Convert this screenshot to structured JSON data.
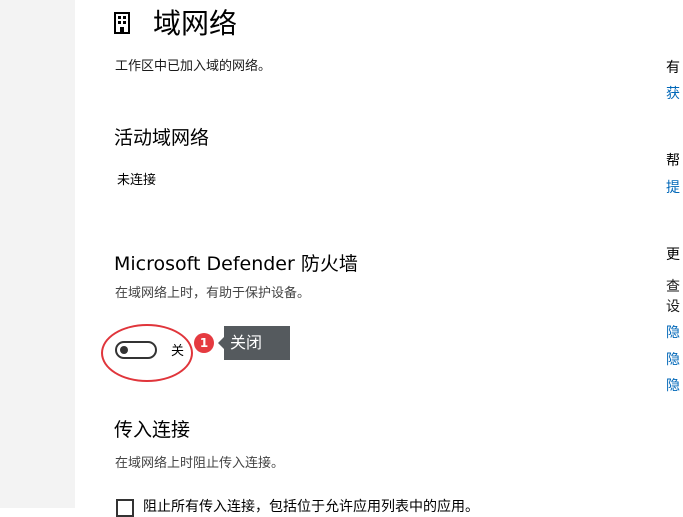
{
  "page": {
    "title": "域网络",
    "description": "工作区中已加入域的网络。",
    "icon": "building-icon"
  },
  "active_networks": {
    "title": "活动域网络",
    "status": "未连接"
  },
  "firewall": {
    "title": "Microsoft Defender 防火墙",
    "description": "在域网络上时，有助于保护设备。",
    "toggle_state": "off",
    "toggle_label": "关",
    "annotation_number": "1",
    "annotation_tooltip": "关闭"
  },
  "incoming": {
    "title": "传入连接",
    "description": "在域网络上时阻止传入连接。",
    "checkbox_label": "阻止所有传入连接，包括位于允许应用列表中的应用。"
  },
  "right_panel": {
    "items": [
      {
        "text": "有",
        "kind": "heading"
      },
      {
        "text": "获",
        "kind": "link"
      },
      {
        "text": "帮",
        "kind": "heading"
      },
      {
        "text": "提",
        "kind": "link"
      },
      {
        "text": "更",
        "kind": "heading"
      },
      {
        "text": "查",
        "kind": "text"
      },
      {
        "text": "设",
        "kind": "text"
      },
      {
        "text": "隐",
        "kind": "link"
      },
      {
        "text": "隐",
        "kind": "link"
      },
      {
        "text": "隐",
        "kind": "link"
      }
    ]
  },
  "colors": {
    "accent_link": "#0067b8",
    "annotation_red": "#e0353b",
    "tooltip_bg": "#555a5e"
  }
}
